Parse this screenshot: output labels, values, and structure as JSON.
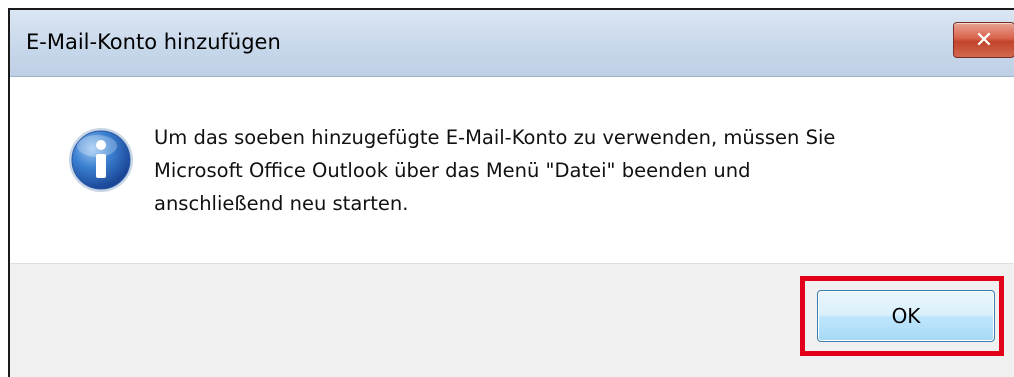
{
  "window": {
    "title": "E-Mail-Konto hinzufügen",
    "close_label": "✕"
  },
  "dialog": {
    "icon": "info-icon",
    "message_lines": [
      "Um das soeben hinzugefügte E-Mail-Konto zu verwenden, müssen Sie",
      "Microsoft Office Outlook über das Menü \"Datei\" beenden und",
      "anschließend neu starten."
    ],
    "ok_label": "OK"
  },
  "colors": {
    "highlight": "#e3001b",
    "titlebar": "#c7d7ea",
    "close_button": "#c1432b"
  }
}
